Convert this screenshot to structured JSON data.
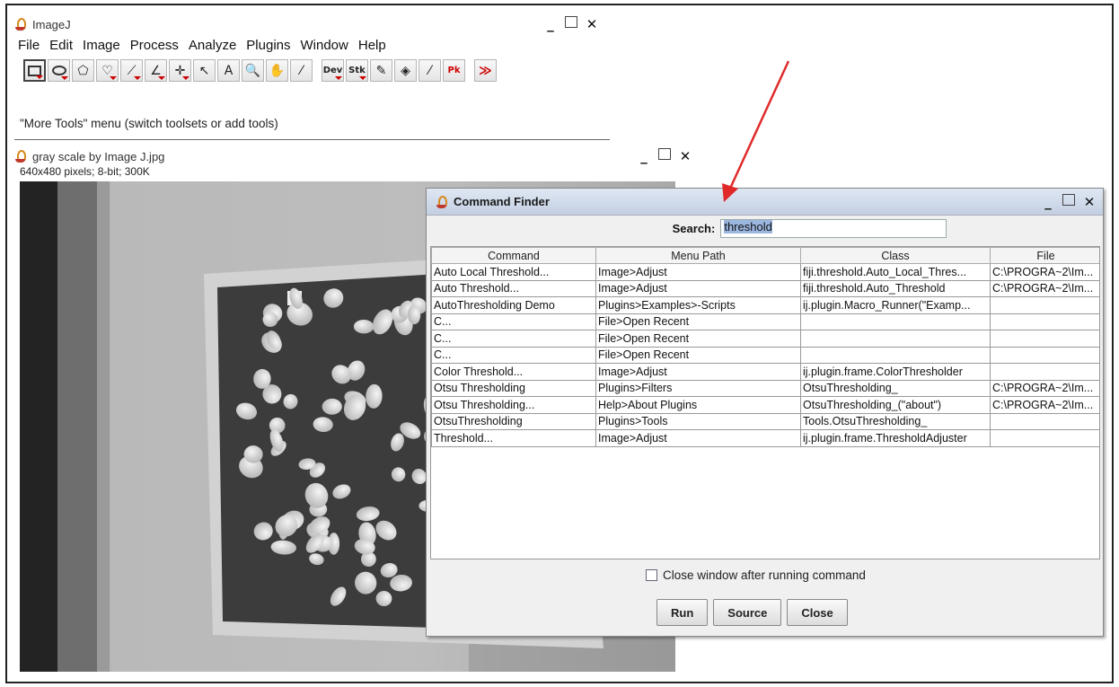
{
  "imagej_window": {
    "title": "ImageJ",
    "menu": [
      "File",
      "Edit",
      "Image",
      "Process",
      "Analyze",
      "Plugins",
      "Window",
      "Help"
    ],
    "tools": [
      {
        "name": "rectangle-tool",
        "glyph": ""
      },
      {
        "name": "oval-tool",
        "glyph": ""
      },
      {
        "name": "polygon-tool",
        "glyph": "⬠"
      },
      {
        "name": "freehand-tool",
        "glyph": "♡"
      },
      {
        "name": "line-tool",
        "glyph": "⟋"
      },
      {
        "name": "angle-tool",
        "glyph": "∠"
      },
      {
        "name": "point-tool",
        "glyph": "✛"
      },
      {
        "name": "wand-tool",
        "glyph": "↖"
      },
      {
        "name": "text-tool",
        "glyph": "A"
      },
      {
        "name": "magnifier-tool",
        "glyph": "🔍"
      },
      {
        "name": "hand-tool",
        "glyph": "✋"
      },
      {
        "name": "color-picker-tool",
        "glyph": "⁄"
      },
      {
        "name": "dev-menu-tool",
        "glyph": "Dev"
      },
      {
        "name": "stk-menu-tool",
        "glyph": "Stk"
      },
      {
        "name": "brush-tool",
        "glyph": "✎"
      },
      {
        "name": "flood-fill-tool",
        "glyph": "◈"
      },
      {
        "name": "pick-tool",
        "glyph": "⁄"
      },
      {
        "name": "image-tool",
        "glyph": "Pk"
      },
      {
        "name": "more-tools",
        "glyph": "≫"
      }
    ],
    "status": "\"More Tools\" menu (switch toolsets or add tools)"
  },
  "image_window": {
    "title": "gray scale by Image J.jpg",
    "info": "640x480 pixels; 8-bit; 300K"
  },
  "command_finder": {
    "title": "Command Finder",
    "search_label": "Search:",
    "search_value": "threshold",
    "columns": [
      "Command",
      "Menu Path",
      "Class",
      "File"
    ],
    "rows": [
      [
        "Auto Local Threshold...",
        "Image>Adjust",
        "fiji.threshold.Auto_Local_Thres...",
        "C:\\PROGRA~2\\Im..."
      ],
      [
        "Auto Threshold...",
        "Image>Adjust",
        "fiji.threshold.Auto_Threshold",
        "C:\\PROGRA~2\\Im..."
      ],
      [
        "AutoThresholding Demo",
        "Plugins>Examples>-Scripts",
        "ij.plugin.Macro_Runner(\"Examp...",
        ""
      ],
      [
        "C...",
        "File>Open Recent",
        "",
        ""
      ],
      [
        "C...",
        "File>Open Recent",
        "",
        ""
      ],
      [
        "C...",
        "File>Open Recent",
        "",
        ""
      ],
      [
        "Color Threshold...",
        "Image>Adjust",
        "ij.plugin.frame.ColorThresholder",
        ""
      ],
      [
        "Otsu Thresholding",
        "Plugins>Filters",
        "OtsuThresholding_",
        "C:\\PROGRA~2\\Im..."
      ],
      [
        "Otsu Thresholding...",
        "Help>About Plugins",
        "OtsuThresholding_(\"about\")",
        "C:\\PROGRA~2\\Im..."
      ],
      [
        "OtsuThresholding",
        "Plugins>Tools",
        "Tools.OtsuThresholding_",
        ""
      ],
      [
        "Threshold...",
        "Image>Adjust",
        "ij.plugin.frame.ThresholdAdjuster",
        ""
      ]
    ],
    "close_checkbox_label": "Close window after running command",
    "close_checkbox_checked": false,
    "buttons": {
      "run": "Run",
      "source": "Source",
      "close": "Close"
    }
  },
  "colors": {
    "arrow": "#e02a2a",
    "dialog_title_bg": "#c9d4e6",
    "search_highlight": "#9bb6df"
  }
}
